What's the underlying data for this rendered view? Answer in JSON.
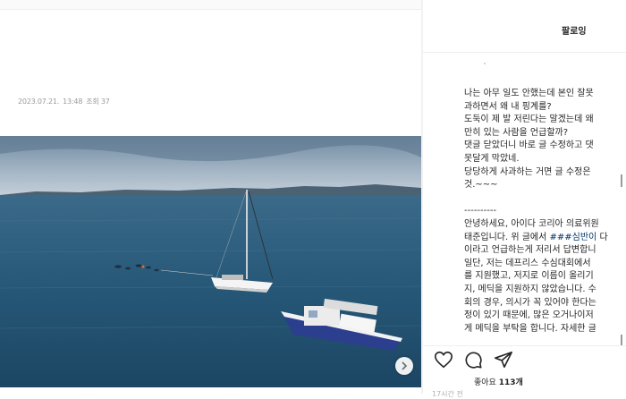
{
  "post": {
    "date": "2023.07.21.",
    "time": "13:48",
    "views_label": "조회 37"
  },
  "panel": {
    "header": "팔로잉",
    "caption_lines": [
      "나는 아무 일도 안했는데 본인 잘못",
      "과하면서 왜 내 핑계를?",
      "도둑이 제 발 저린다는 말겠는데 왜",
      "만히 있는 사람을 언급할까?",
      "댓글 닫았더니 바로 글 수정하고 댓",
      "못달게 막았네.",
      "당당하게 사과하는 거면 글 수정은",
      "것.~~~",
      "",
      "----------",
      "안녕하세요, 아이다 코리아 의료위원",
      "태준입니다. 위 글에서 ###심반이 다",
      "이라고 언급하는게 저리서 답변합니",
      "일단, 저는 데프리스 수심대회에서",
      "를 지원했고, 저지로 이름이 올리기",
      "지, 메딕을 지원하지 않았습니다. 수",
      "회의 경우, 의시가 꼭 있어야 한다는",
      "정이 있기 때문에, 많은 오거나이저",
      "게 메딕을 부탁을 합니다. 자세한 글"
    ],
    "tag_word": "###심반이",
    "likes_prefix": "좋아요",
    "likes_count": "113개",
    "time_ago": "17시간 전"
  },
  "icons": {
    "like": "heart-icon",
    "comment": "comment-icon",
    "share": "share-icon",
    "next": "chevron-right-icon"
  },
  "colors": {
    "sea": "#23506e",
    "sky": "#8fa3b6",
    "hull_white": "#f2f2f2",
    "boat_blue": "#2c3f8f"
  }
}
